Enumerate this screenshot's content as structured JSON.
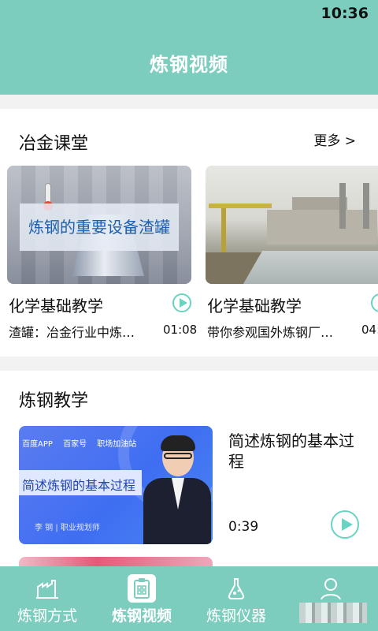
{
  "status_bar": {
    "time": "10:36"
  },
  "header": {
    "title": "炼钢视频"
  },
  "metallurgy_class": {
    "title": "冶金课堂",
    "more_label": "更多 >",
    "cards": [
      {
        "thumb_banner": "炼钢的重要设备渣罐",
        "title": "化学基础教学",
        "desc": "渣罐：冶金行业中炼…",
        "duration": "01:08"
      },
      {
        "title": "化学基础教学",
        "desc": "带你参观国外炼钢厂…",
        "duration": "04:"
      }
    ]
  },
  "steelmaking_teaching": {
    "title": "炼钢教学",
    "items": [
      {
        "thumb_strip": [
          "百度APP",
          "百家号",
          "职场加油站"
        ],
        "thumb_banner": "简述炼钢的基本过程",
        "thumb_caption": "李 钢 | 职业规划师",
        "title": "简述炼钢的基本过程",
        "duration": "0:39"
      }
    ]
  },
  "bottom_nav": {
    "items": [
      {
        "label": "炼钢方式",
        "icon": "factory-icon",
        "active": false
      },
      {
        "label": "炼钢视频",
        "icon": "video-clipboard-icon",
        "active": true
      },
      {
        "label": "炼钢仪器",
        "icon": "flask-icon",
        "active": false
      },
      {
        "label": "",
        "icon": "user-icon",
        "active": false
      }
    ]
  },
  "colors": {
    "primary": "#7dcdbf",
    "play_accent": "#69d3c4",
    "banner_text": "#1b5fb0"
  }
}
